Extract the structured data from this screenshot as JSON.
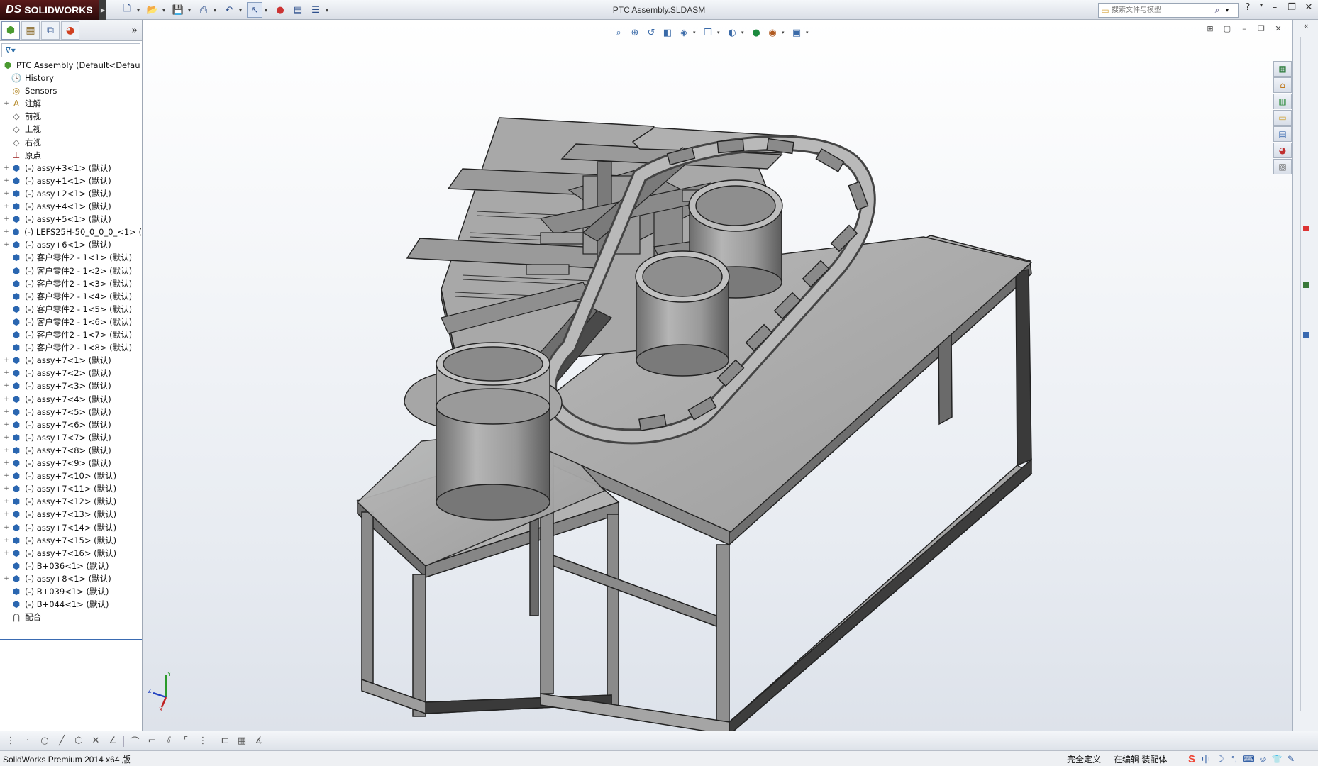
{
  "app": {
    "logo_text": "SOLIDWORKS",
    "logo_prefix": "DS",
    "document_title": "PTC Assembly.SLDASM"
  },
  "search": {
    "placeholder": "搜索文件与模型"
  },
  "feature_tree": {
    "root": "PTC Assembly  (Default<Defau",
    "items": [
      {
        "label": "History",
        "icon": "history-icon",
        "expand": ""
      },
      {
        "label": "Sensors",
        "icon": "sensors-icon",
        "expand": ""
      },
      {
        "label": "注解",
        "icon": "annotations-icon",
        "expand": "+"
      },
      {
        "label": "前视",
        "icon": "plane-icon",
        "expand": ""
      },
      {
        "label": "上视",
        "icon": "plane-icon",
        "expand": ""
      },
      {
        "label": "右视",
        "icon": "plane-icon",
        "expand": ""
      },
      {
        "label": "原点",
        "icon": "origin-icon",
        "expand": ""
      },
      {
        "label": "(-) assy+3<1> (默认)",
        "icon": "subassembly-icon",
        "expand": "+"
      },
      {
        "label": "(-) assy+1<1> (默认)",
        "icon": "subassembly-icon",
        "expand": "+"
      },
      {
        "label": "(-) assy+2<1> (默认)",
        "icon": "subassembly-icon",
        "expand": "+"
      },
      {
        "label": "(-) assy+4<1> (默认)",
        "icon": "subassembly-icon",
        "expand": "+"
      },
      {
        "label": "(-) assy+5<1> (默认)",
        "icon": "subassembly-icon",
        "expand": "+"
      },
      {
        "label": "(-) LEFS25H-50_0_0_0_<1> (",
        "icon": "subassembly-icon",
        "expand": "+"
      },
      {
        "label": "(-) assy+6<1> (默认)",
        "icon": "subassembly-icon",
        "expand": "+"
      },
      {
        "label": "(-) 客户零件2 - 1<1> (默认)",
        "icon": "part-icon",
        "expand": ""
      },
      {
        "label": "(-) 客户零件2 - 1<2> (默认)",
        "icon": "part-icon",
        "expand": ""
      },
      {
        "label": "(-) 客户零件2 - 1<3> (默认)",
        "icon": "part-icon",
        "expand": ""
      },
      {
        "label": "(-) 客户零件2 - 1<4> (默认)",
        "icon": "part-icon",
        "expand": ""
      },
      {
        "label": "(-) 客户零件2 - 1<5> (默认)",
        "icon": "part-icon",
        "expand": ""
      },
      {
        "label": "(-) 客户零件2 - 1<6> (默认)",
        "icon": "part-icon",
        "expand": ""
      },
      {
        "label": "(-) 客户零件2 - 1<7> (默认)",
        "icon": "part-icon",
        "expand": ""
      },
      {
        "label": "(-) 客户零件2 - 1<8> (默认)",
        "icon": "part-icon",
        "expand": ""
      },
      {
        "label": "(-) assy+7<1> (默认)",
        "icon": "subassembly-icon",
        "expand": "+"
      },
      {
        "label": "(-) assy+7<2> (默认)",
        "icon": "subassembly-icon",
        "expand": "+"
      },
      {
        "label": "(-) assy+7<3> (默认)",
        "icon": "subassembly-icon",
        "expand": "+"
      },
      {
        "label": "(-) assy+7<4> (默认)",
        "icon": "subassembly-icon",
        "expand": "+"
      },
      {
        "label": "(-) assy+7<5> (默认)",
        "icon": "subassembly-icon",
        "expand": "+"
      },
      {
        "label": "(-) assy+7<6> (默认)",
        "icon": "subassembly-icon",
        "expand": "+"
      },
      {
        "label": "(-) assy+7<7> (默认)",
        "icon": "subassembly-icon",
        "expand": "+"
      },
      {
        "label": "(-) assy+7<8> (默认)",
        "icon": "subassembly-icon",
        "expand": "+"
      },
      {
        "label": "(-) assy+7<9> (默认)",
        "icon": "subassembly-icon",
        "expand": "+"
      },
      {
        "label": "(-) assy+7<10> (默认)",
        "icon": "subassembly-icon",
        "expand": "+"
      },
      {
        "label": "(-) assy+7<11> (默认)",
        "icon": "subassembly-icon",
        "expand": "+"
      },
      {
        "label": "(-) assy+7<12> (默认)",
        "icon": "subassembly-icon",
        "expand": "+"
      },
      {
        "label": "(-) assy+7<13> (默认)",
        "icon": "subassembly-icon",
        "expand": "+"
      },
      {
        "label": "(-) assy+7<14> (默认)",
        "icon": "subassembly-icon",
        "expand": "+"
      },
      {
        "label": "(-) assy+7<15> (默认)",
        "icon": "subassembly-icon",
        "expand": "+"
      },
      {
        "label": "(-) assy+7<16> (默认)",
        "icon": "subassembly-icon",
        "expand": "+"
      },
      {
        "label": "(-) B+036<1> (默认)",
        "icon": "subassembly-icon",
        "expand": ""
      },
      {
        "label": "(-) assy+8<1> (默认)",
        "icon": "subassembly-icon",
        "expand": "+"
      },
      {
        "label": "(-) B+039<1> (默认)",
        "icon": "subassembly-icon",
        "expand": ""
      },
      {
        "label": "(-) B+044<1> (默认)",
        "icon": "subassembly-icon",
        "expand": ""
      },
      {
        "label": "配合",
        "icon": "mates-icon",
        "expand": ""
      }
    ]
  },
  "triad": {
    "x": "X",
    "y": "Y",
    "z": "Z"
  },
  "status": {
    "left": "SolidWorks Premium 2014 x64 版",
    "definition": "完全定义",
    "mode": "在编辑 装配体"
  },
  "tray": {
    "ime": "中"
  },
  "colors": {
    "accent": "#3a6bb2",
    "model_face": "#9a9a9a",
    "model_top": "#b4b4b4",
    "model_dark": "#3c3c3c"
  }
}
